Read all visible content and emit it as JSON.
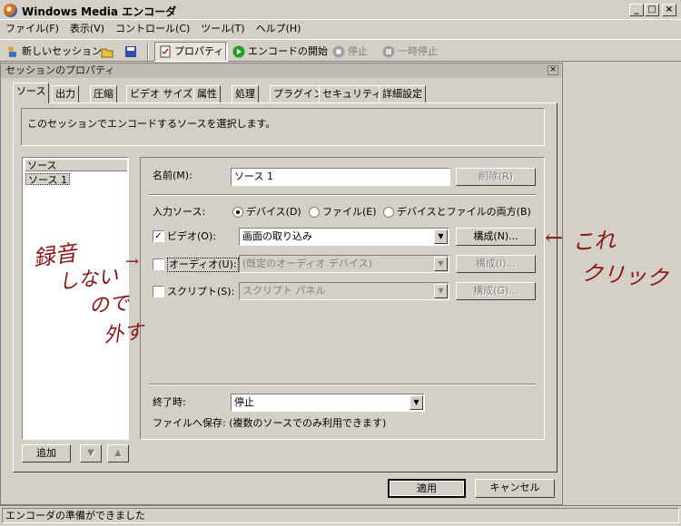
{
  "window": {
    "title": "Windows Media エンコーダ",
    "minimize": "_",
    "maximize": "□",
    "close": "×"
  },
  "menu": [
    "ファイル(F)",
    "表示(V)",
    "コントロール(C)",
    "ツール(T)",
    "ヘルプ(H)"
  ],
  "toolbar": {
    "new_session": "新しいセッション",
    "properties": "プロパティ",
    "start_encoding": "エンコードの開始",
    "stop": "停止",
    "pause": "一時停止"
  },
  "panel": {
    "title": "セッションのプロパティ",
    "close": "×",
    "tabs": [
      "ソース",
      "出力",
      "圧縮",
      "ビデオ サイズ",
      "属性",
      "処理",
      "プラグイン",
      "セキュリティ",
      "詳細設定"
    ],
    "active_tab": "ソース",
    "description": "このセッションでエンコードするソースを選択します。"
  },
  "source_list": {
    "header": "ソース",
    "items": [
      "ソース 1"
    ],
    "add_button": "追加",
    "down_button": "▼",
    "up_button": "▲"
  },
  "properties": {
    "name_label": "名前(M):",
    "name_value": "ソース 1",
    "delete_button": "削除(R)",
    "input_source_label": "入力ソース:",
    "radio_device": "デバイス(D)",
    "radio_file": "ファイル(E)",
    "radio_both": "デバイスとファイルの両方(B)",
    "video_label": "ビデオ(O):",
    "video_checked": true,
    "video_value": "画面の取り込み",
    "video_config": "構成(N)...",
    "audio_label": "オーディオ(U):",
    "audio_checked": false,
    "audio_value": "(既定のオーディオ デバイス)",
    "audio_config": "構成(I)...",
    "script_label": "スクリプト(S):",
    "script_checked": false,
    "script_value": "スクリプト パネル",
    "script_config": "構成(G)...",
    "end_label": "終了時:",
    "end_value": "停止",
    "save_note": "ファイルへ保存: (複数のソースでのみ利用できます)"
  },
  "footer": {
    "apply_button": "適用",
    "cancel_button": "キャンセル"
  },
  "status": "エンコーダの準備ができました",
  "annotations": {
    "left_lines": [
      "録音",
      "しない",
      "ので",
      "外す"
    ],
    "right_lines": [
      "これ",
      "クリック"
    ],
    "arrow_left": "←",
    "arrow_right": "→"
  },
  "colors": {
    "annotation": "#8b1414",
    "title_text": "#000000"
  }
}
